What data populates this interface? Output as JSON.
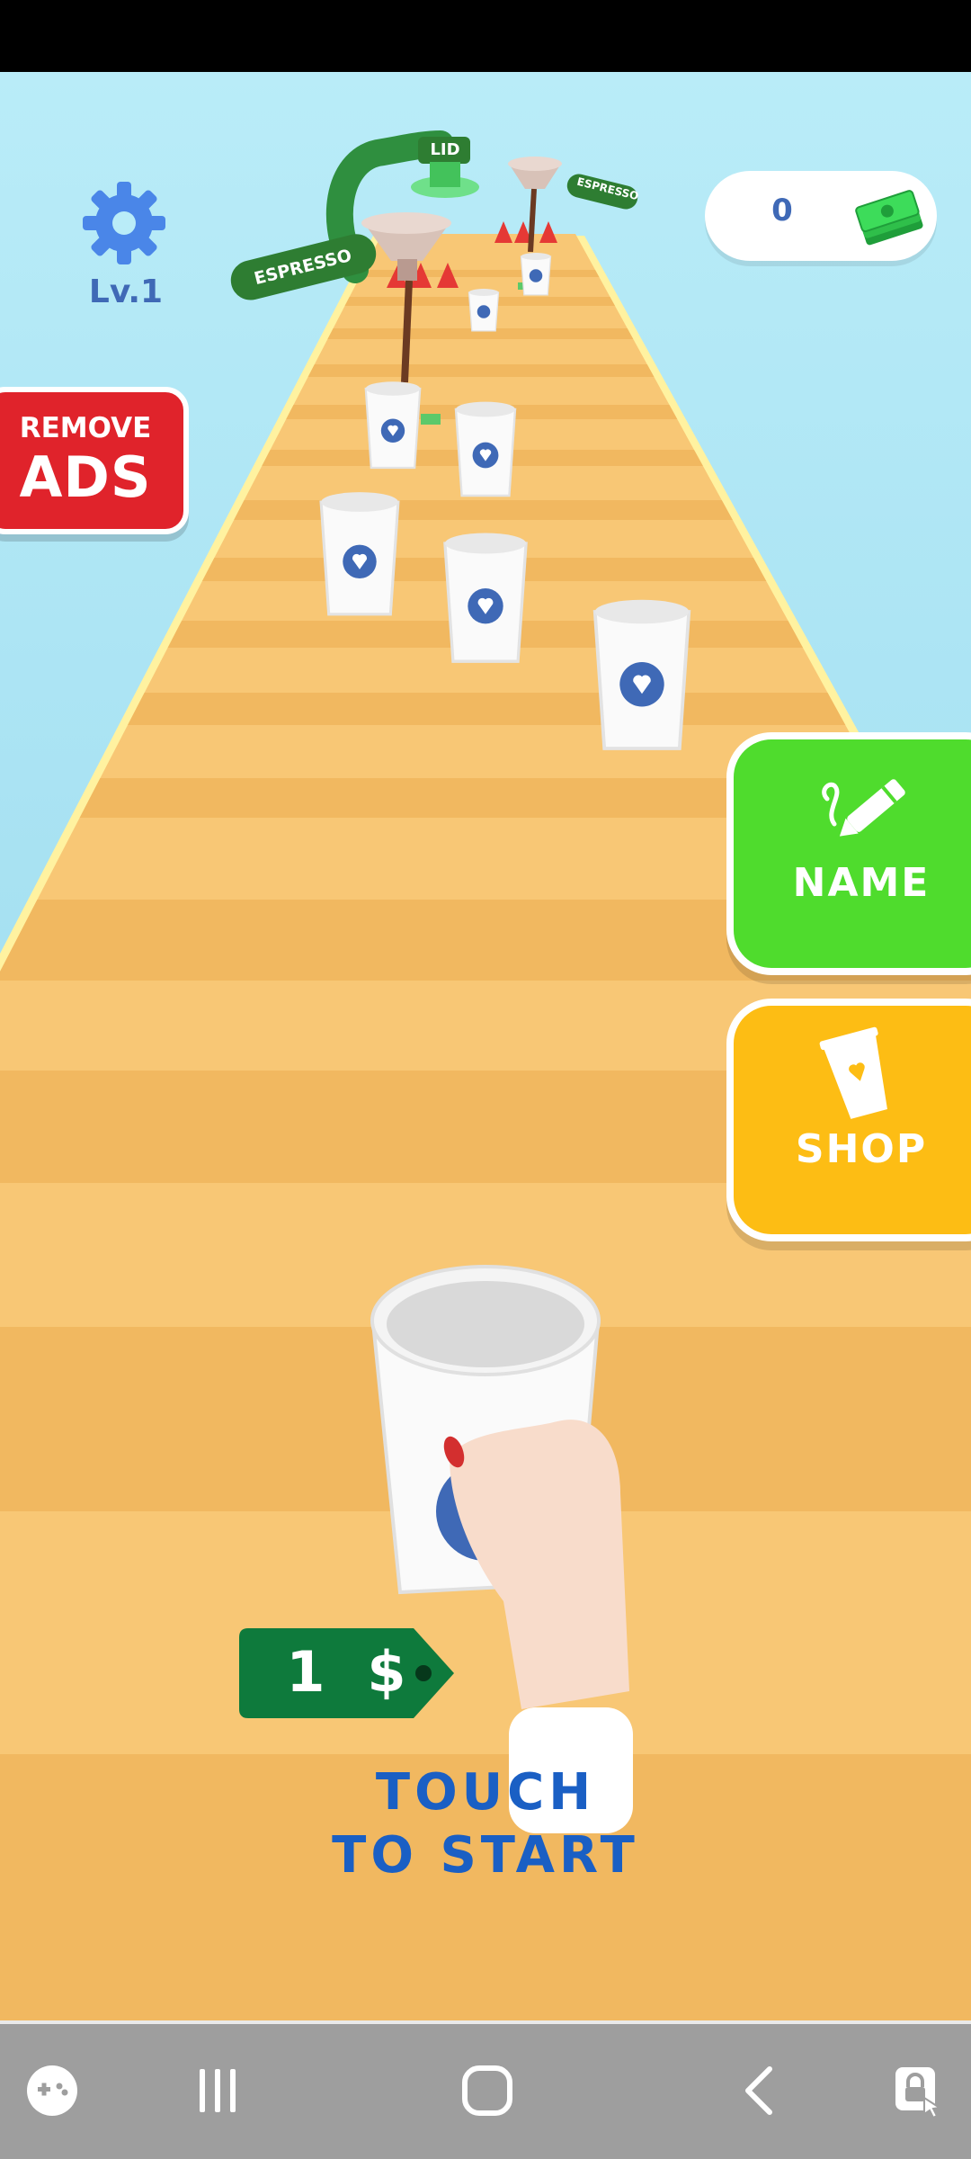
{
  "hud": {
    "level": "Lv.1",
    "money": "0",
    "settings_icon": "gear-icon",
    "money_icon": "cash-stack-icon"
  },
  "remove_ads": {
    "line1": "REMOVE",
    "line2": "ADS"
  },
  "side_buttons": {
    "name": {
      "label": "NAME",
      "icon": "pencil-icon",
      "color": "#4fdc2d"
    },
    "shop": {
      "label": "SHOP",
      "icon": "cup-icon",
      "color": "#fdbd14"
    }
  },
  "track_props": {
    "espresso_left": "ESPRESSO",
    "espresso_right": "ESPRESSO",
    "lid": "LID"
  },
  "price_tag": {
    "value": "1",
    "currency": "$"
  },
  "start_prompt": {
    "line1": "TOUCH",
    "line2": "TO START"
  },
  "navbar": {
    "icons": [
      "game-tools-icon",
      "recent-apps-icon",
      "home-icon",
      "back-icon",
      "lock-app-icon"
    ]
  },
  "colors": {
    "sky": "#aee6f4",
    "track": "#f8c775",
    "stripe": "#f0b55c",
    "accent_blue": "#3f69b6",
    "remove_ads_red": "#e0232b"
  }
}
